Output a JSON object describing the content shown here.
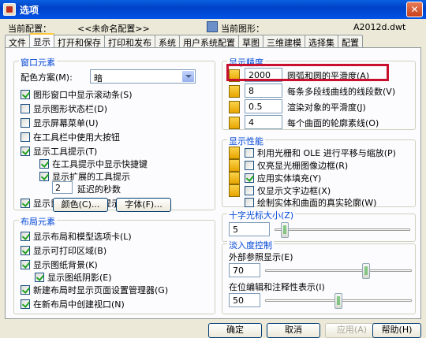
{
  "window": {
    "title": "选项",
    "close_label": "✕"
  },
  "info": {
    "current_profile_label": "当前配置：",
    "current_profile_value": "<<未命名配置>>",
    "current_drawing_label": "当前图形：",
    "current_drawing_value": "A2012d.dwt"
  },
  "tabs": [
    "文件",
    "显示",
    "打开和保存",
    "打印和发布",
    "系统",
    "用户系统配置",
    "草图",
    "三维建模",
    "选择集",
    "配置"
  ],
  "window_elements": {
    "legend": "窗口元素",
    "scheme_label": "配色方案(M):",
    "scheme_value": "暗",
    "checks": [
      {
        "label": "图形窗口中显示滚动条(S)",
        "checked": true
      },
      {
        "label": "显示图形状态栏(D)",
        "checked": false
      },
      {
        "label": "显示屏幕菜单(U)",
        "checked": false
      },
      {
        "label": "在工具栏中使用大按钮",
        "checked": false
      },
      {
        "label": "显示工具提示(T)",
        "checked": true
      },
      {
        "label": "在工具提示中显示快捷键",
        "checked": true
      },
      {
        "label": "显示扩展的工具提示",
        "checked": true
      },
      {
        "label": "显示鼠标悬停工具提示",
        "checked": true
      }
    ],
    "delay_value": "2",
    "delay_label": "延迟的秒数",
    "colors_button": "颜色(C)...",
    "fonts_button": "字体(F)..."
  },
  "layout_elements": {
    "legend": "布局元素",
    "checks": [
      {
        "label": "显示布局和模型选项卡(L)",
        "checked": true
      },
      {
        "label": "显示可打印区域(B)",
        "checked": true
      },
      {
        "label": "显示图纸背景(K)",
        "checked": true
      },
      {
        "label": "显示图纸阴影(E)",
        "checked": true
      },
      {
        "label": "新建布局时显示页面设置管理器(G)",
        "checked": true
      },
      {
        "label": "在新布局中创建视口(N)",
        "checked": true
      }
    ]
  },
  "display_resolution": {
    "legend": "显示精度",
    "rows": [
      {
        "value": "2000",
        "label": "圆弧和圆的平滑度(A)"
      },
      {
        "value": "8",
        "label": "每条多段线曲线的线段数(V)"
      },
      {
        "value": "0.5",
        "label": "渲染对象的平滑度(J)"
      },
      {
        "value": "4",
        "label": "每个曲面的轮廓素线(O)"
      }
    ]
  },
  "display_performance": {
    "legend": "显示性能",
    "checks": [
      {
        "label": "利用光栅和 OLE 进行平移与缩放(P)",
        "checked": false
      },
      {
        "label": "仅亮显光栅图像边框(R)",
        "checked": false
      },
      {
        "label": "应用实体填充(Y)",
        "checked": true
      },
      {
        "label": "仅显示文字边框(X)",
        "checked": false
      },
      {
        "label": "绘制实体和曲面的真实轮廓(W)",
        "checked": false
      }
    ]
  },
  "crosshair": {
    "legend": "十字光标大小(Z)",
    "value": "5",
    "level_percent": 5
  },
  "fade": {
    "legend": "淡入度控制",
    "xref_label": "外部参照显示(E)",
    "xref_value": "70",
    "xref_level": 70,
    "inplace_label": "在位编辑和注释性表示(I)",
    "inplace_value": "50",
    "inplace_level": 50
  },
  "buttons": {
    "ok": "确定",
    "cancel": "取消",
    "apply": "应用(A)",
    "help": "帮助(H)"
  }
}
